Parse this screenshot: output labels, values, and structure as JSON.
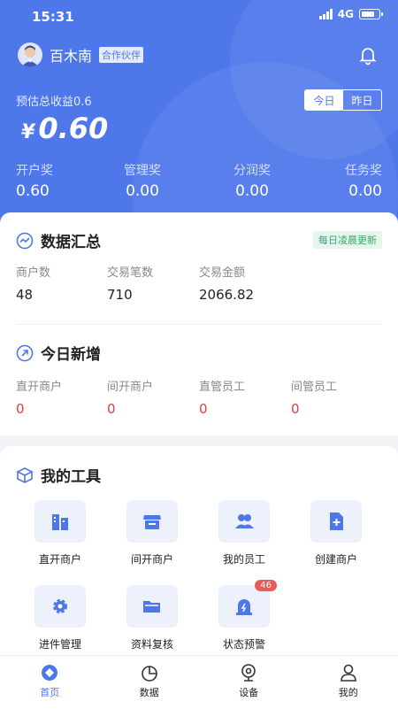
{
  "status_bar": {
    "time": "15:31",
    "network": "4G"
  },
  "user": {
    "name": "百木南",
    "badge": "合作伙伴"
  },
  "earnings": {
    "label": "预估总收益0.6",
    "toggle": [
      "今日",
      "昨日"
    ],
    "currency": "¥",
    "amount": "0.60",
    "stats": [
      {
        "label": "开户奖",
        "value": "0.60"
      },
      {
        "label": "管理奖",
        "value": "0.00"
      },
      {
        "label": "分润奖",
        "value": "0.00"
      },
      {
        "label": "任务奖",
        "value": "0.00"
      }
    ]
  },
  "summary": {
    "title": "数据汇总",
    "update_badge": "每日凌晨更新",
    "items": [
      {
        "label": "商户数",
        "value": "48"
      },
      {
        "label": "交易笔数",
        "value": "710"
      },
      {
        "label": "交易金额",
        "value": "2066.82"
      }
    ]
  },
  "today_new": {
    "title": "今日新增",
    "items": [
      {
        "label": "直开商户",
        "value": "0"
      },
      {
        "label": "间开商户",
        "value": "0"
      },
      {
        "label": "直管员工",
        "value": "0"
      },
      {
        "label": "间管员工",
        "value": "0"
      }
    ]
  },
  "tools": {
    "title": "我的工具",
    "items": [
      {
        "label": "直开商户",
        "icon": "building-icon"
      },
      {
        "label": "间开商户",
        "icon": "storefront-icon"
      },
      {
        "label": "我的员工",
        "icon": "people-icon"
      },
      {
        "label": "创建商户",
        "icon": "add-document-icon"
      },
      {
        "label": "进件管理",
        "icon": "gear-icon"
      },
      {
        "label": "资料复核",
        "icon": "folder-icon"
      },
      {
        "label": "状态预警",
        "icon": "alarm-icon",
        "badge": "46"
      }
    ]
  },
  "tabbar": [
    {
      "label": "首页",
      "icon": "home-icon",
      "active": true
    },
    {
      "label": "数据",
      "icon": "chart-pie-icon"
    },
    {
      "label": "设备",
      "icon": "camera-icon"
    },
    {
      "label": "我的",
      "icon": "profile-icon"
    }
  ],
  "colors": {
    "primary": "#4e77ea",
    "badge_green": "#3aa56d",
    "alert_red": "#e04040"
  }
}
